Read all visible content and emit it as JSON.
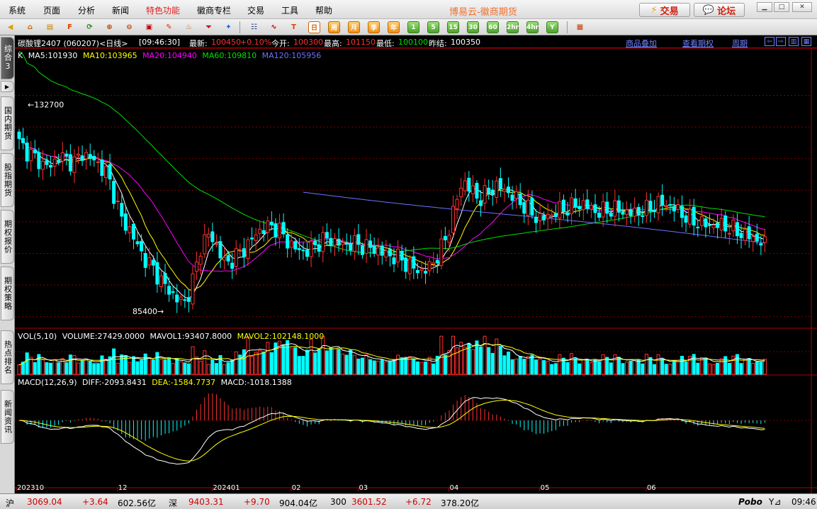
{
  "menu": {
    "items": [
      "系统",
      "页面",
      "分析",
      "新闻",
      "特色功能",
      "徽商专栏",
      "交易",
      "工具",
      "帮助"
    ],
    "highlight_index": 4,
    "brand": "博易云-徽商期货",
    "trade_button": "交易",
    "forum_button": "论坛"
  },
  "toolbar": {
    "periods": [
      "日",
      "周",
      "月",
      "季",
      "年",
      "1",
      "5",
      "15",
      "30",
      "60",
      "2hr",
      "4hr",
      "Y"
    ],
    "active_period": "日"
  },
  "side_tabs": [
    "综合3",
    "国内期货",
    "股指期货",
    "期权报价",
    "期权策略",
    "热点排名",
    "新闻资讯"
  ],
  "info_bar": {
    "symbol": "碳酸锂2407 (060207)<日线>",
    "time": "[09:46:30]",
    "latest_label": "最新:",
    "latest": "100450",
    "change": "+0.10%",
    "open_label": "今开:",
    "open": "100300",
    "high_label": "最高:",
    "high": "101150",
    "low_label": "最低:",
    "low": "100100",
    "prev_label": "昨结:",
    "prev": "100350",
    "link_overlay": "商品叠加",
    "link_options": "查看期权",
    "link_period": "周期"
  },
  "ma_legend": {
    "k": "K",
    "ma5": "MA5:101930",
    "ma10": "MA10:103965",
    "ma20": "MA20:104940",
    "ma60": "MA60:109810",
    "ma120": "MA120:105956"
  },
  "vol_legend": {
    "name": "VOL(5,10)",
    "volume": "VOLUME:27429.0000",
    "mavol1": "MAVOL1:93407.8000",
    "mavol2": "MAVOL2:102148.1000"
  },
  "macd_legend": {
    "name": "MACD(12,26,9)",
    "diff": "DIFF:-2093.8431",
    "dea": "DEA:-1584.7737",
    "macd": "MACD:-1018.1388"
  },
  "price_annotations": {
    "high": "132700",
    "low": "85400"
  },
  "x_labels": [
    "202310",
    "12",
    "202401",
    "02",
    "03",
    "04",
    "05",
    "06"
  ],
  "status": {
    "sh_label": "沪",
    "sh_value": "3069.04",
    "sh_change": "+3.64",
    "sh_amount": "602.56亿",
    "sz_label": "深",
    "sz_value": "9403.31",
    "sz_change": "+9.70",
    "sz_amount": "904.04亿",
    "i300_label": "300",
    "i300_value": "3601.52",
    "i300_change": "+6.72",
    "i300_amount": "378.20亿",
    "brand": "Pobo",
    "clock": "09:46"
  },
  "colors": {
    "up": "#ff3030",
    "down": "#00ffff",
    "ma5": "#ffffff",
    "ma10": "#ffff00",
    "ma20": "#ff00ff",
    "ma60": "#00e000",
    "ma120": "#7070ff"
  },
  "chart_data": {
    "type": "candlestick",
    "symbol": "碳酸锂2407",
    "period": "daily",
    "date_range": [
      "2023-10",
      "2024-06"
    ],
    "annotated_high": 132700,
    "annotated_low": 85400,
    "last": {
      "latest": 100450,
      "open": 100300,
      "high": 101150,
      "low": 100100,
      "prev_settle": 100350
    },
    "moving_averages": {
      "MA5": 101930,
      "MA10": 103965,
      "MA20": 104940,
      "MA60": 109810,
      "MA120": 105956
    },
    "volume": {
      "VOLUME": 27429,
      "MAVOL1": 93407.8,
      "MAVOL2": 102148.1
    },
    "macd": {
      "DIFF": -2093.8431,
      "DEA": -1584.7737,
      "MACD": -1018.1388
    },
    "close_path": [
      124000,
      122000,
      120500,
      119000,
      118500,
      121000,
      120000,
      119500,
      121500,
      120500,
      119000,
      117000,
      112000,
      106000,
      104000,
      100000,
      97000,
      95000,
      92000,
      90000,
      88000,
      87500,
      93000,
      101000,
      103000,
      100000,
      96000,
      97500,
      99000,
      101000,
      103500,
      104500,
      105000,
      103500,
      101000,
      99500,
      99000,
      100000,
      101500,
      102000,
      101000,
      100500,
      101000,
      100500,
      100000,
      99500,
      98500,
      98000,
      97500,
      96000,
      95000,
      94500,
      96000,
      99000,
      103000,
      110000,
      115500,
      113000,
      111000,
      112500,
      114000,
      113500,
      112000,
      110500,
      109000,
      107000,
      106500,
      107500,
      108500,
      109000,
      109500,
      110000,
      109000,
      108000,
      108500,
      108800,
      108300,
      107800,
      108000,
      108500,
      109500,
      110200,
      109500,
      108500,
      107000,
      106000,
      105500,
      105000,
      105200,
      104800,
      104000,
      103200,
      102500,
      101800,
      100600
    ]
  }
}
